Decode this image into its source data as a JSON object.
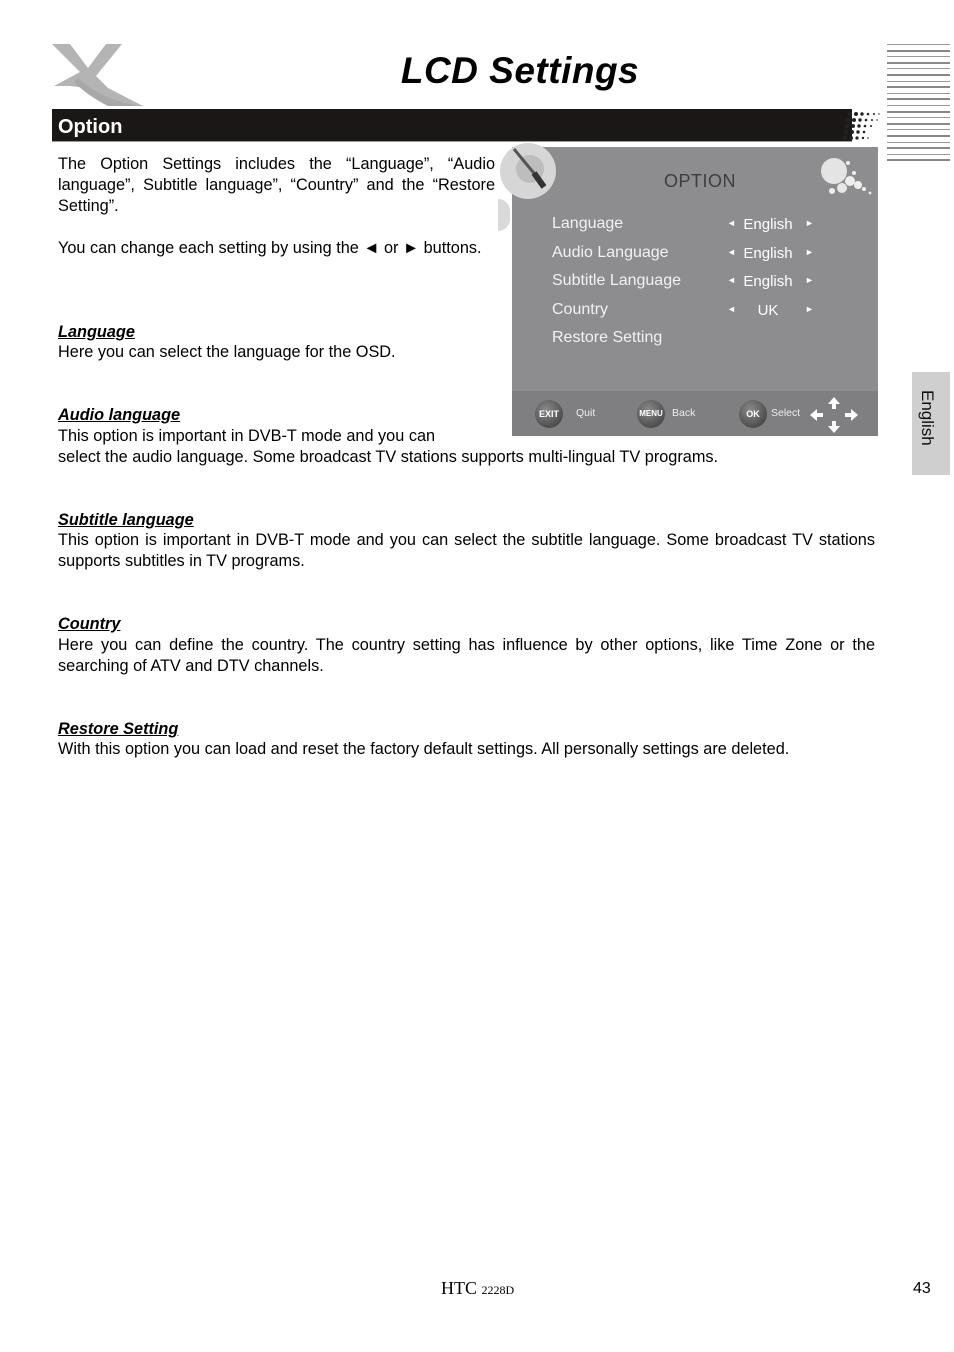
{
  "page": {
    "title": "LCD Settings",
    "section": "Option",
    "side_tab": "English",
    "footer_model_prefix": "HTC",
    "footer_model_number": "2228D",
    "page_number": "43"
  },
  "intro": {
    "p1": "The Option Settings includes the “Language”, “Audio language”, Subtitle language”, “Country” and the “Restore Setting”.",
    "p2": "You can change each setting by using the ◄ or ► buttons."
  },
  "sections": [
    {
      "heading": "Language",
      "text": "Here you can select the language for the OSD."
    },
    {
      "heading": "Audio language",
      "text_a": "This option is important in DVB-T mode and you can",
      "text_b": "select the audio language. Some broadcast TV stations supports multi-lingual TV programs."
    },
    {
      "heading": "Subtitle language",
      "text": "This option is important in DVB-T mode and you can select the subtitle language. Some broadcast TV stations supports subtitles in TV programs."
    },
    {
      "heading": "Country",
      "text": "Here you can define the country. The country setting has influence by other options, like Time Zone or the searching of ATV and DTV channels."
    },
    {
      "heading": "Restore Setting",
      "text": "With this option you can load and reset the factory default settings. All personally settings are deleted."
    }
  ],
  "osd": {
    "title": "OPTION",
    "left_arrow": "◄",
    "right_arrow": "►",
    "items": [
      {
        "label": "Language",
        "value": "English"
      },
      {
        "label": "Audio Language",
        "value": "English"
      },
      {
        "label": "Subtitle Language",
        "value": "English"
      },
      {
        "label": "Country",
        "value": "UK"
      },
      {
        "label": "Restore Setting",
        "value": ""
      }
    ],
    "footer": [
      {
        "key": "EXIT",
        "action": "Quit"
      },
      {
        "key": "MENU",
        "action": "Back"
      },
      {
        "key": "OK",
        "action": "Select"
      }
    ]
  }
}
